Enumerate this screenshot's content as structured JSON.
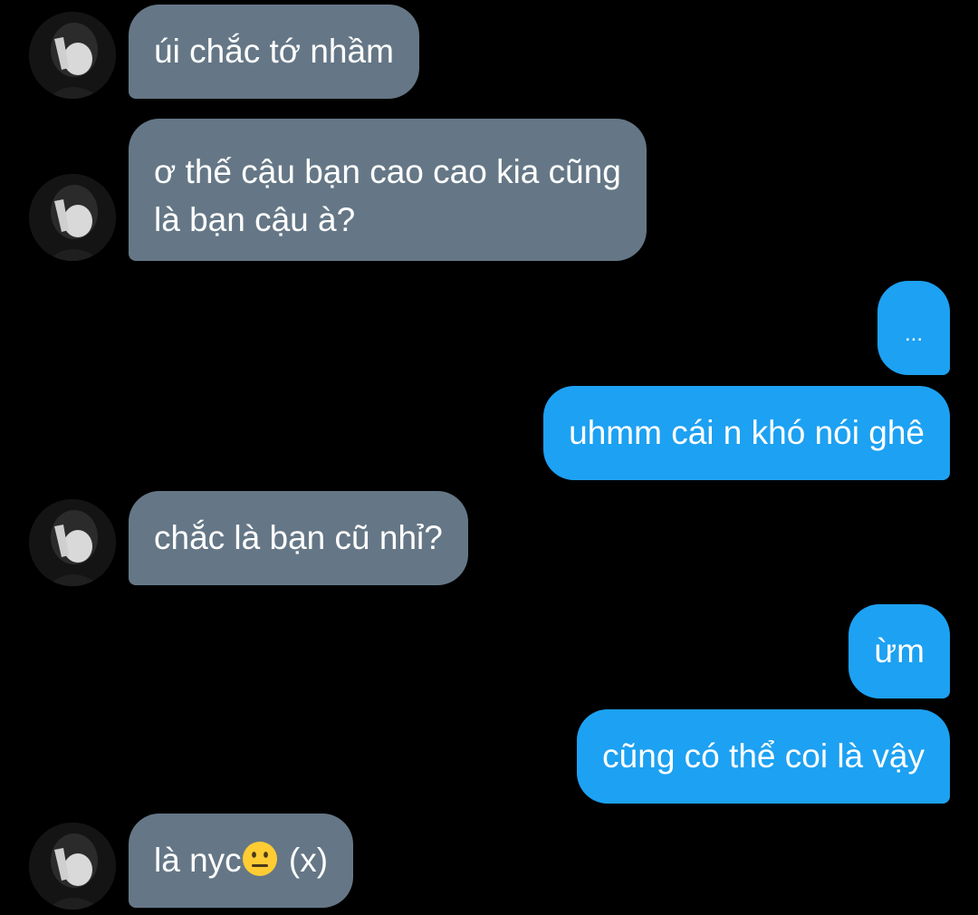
{
  "conversation": {
    "messages": [
      {
        "direction": "incoming",
        "text": "úi chắc tớ nhầm"
      },
      {
        "direction": "incoming",
        "line1": "ơ thế cậu bạn cao cao kia cũng",
        "line2": "là bạn cậu à?"
      },
      {
        "direction": "outgoing",
        "text": "..."
      },
      {
        "direction": "outgoing",
        "text": "uhmm cái n khó nói ghê"
      },
      {
        "direction": "incoming",
        "text": "chắc là bạn cũ nhỉ?"
      },
      {
        "direction": "outgoing",
        "text": "ừm"
      },
      {
        "direction": "outgoing",
        "text": "cũng có thể coi là vậy"
      },
      {
        "direction": "incoming",
        "text_before": "là nyc",
        "emoji": "neutral-face-emoji",
        "text_after": " (x)"
      }
    ]
  },
  "colors": {
    "background": "#000000",
    "incoming_bubble": "#657786",
    "outgoing_bubble": "#1da1f2",
    "text": "#ffffff"
  },
  "icons": {
    "avatar": "user-avatar-photo"
  }
}
